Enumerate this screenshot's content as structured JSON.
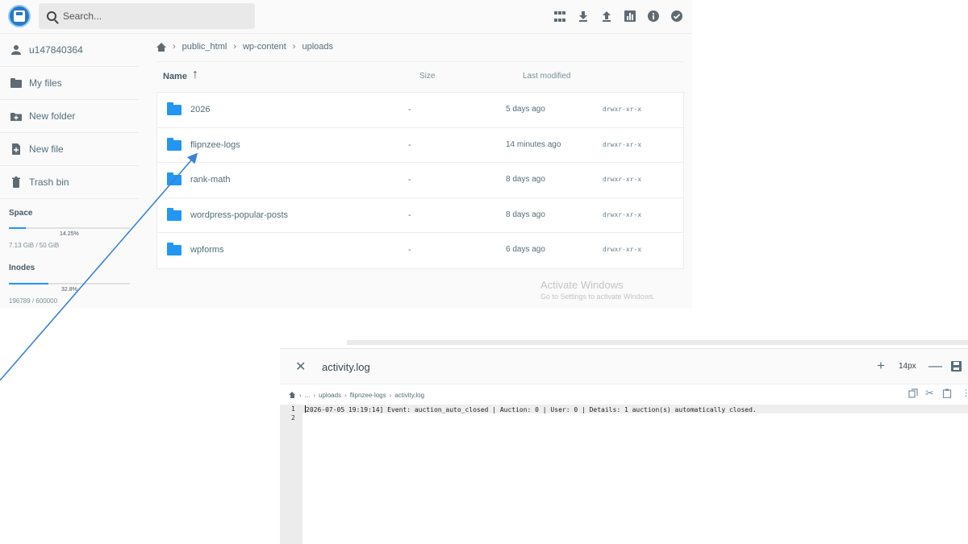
{
  "header": {
    "search_placeholder": "Search...",
    "toolbar_icons": [
      "grid-view-icon",
      "download-icon",
      "upload-icon",
      "chart-icon",
      "info-icon",
      "check-circle-icon"
    ]
  },
  "sidebar": {
    "items": [
      {
        "label": "u147840364",
        "icon": "user-icon"
      },
      {
        "label": "My files",
        "icon": "folder-icon"
      },
      {
        "label": "New folder",
        "icon": "new-folder-icon"
      },
      {
        "label": "New file",
        "icon": "new-file-icon"
      },
      {
        "label": "Trash bin",
        "icon": "trash-icon"
      }
    ],
    "space": {
      "title": "Space",
      "percent": "14.25%",
      "value": "7.13 GiB / 50 GiB",
      "fraction": 0.1425
    },
    "inodes": {
      "title": "Inodes",
      "percent": "32.8%",
      "value": "196789 / 600000",
      "fraction": 0.328
    }
  },
  "breadcrumb": [
    "public_html",
    "wp-content",
    "uploads"
  ],
  "list": {
    "columns": {
      "name": "Name",
      "size": "Size",
      "modified": "Last modified"
    },
    "rows": [
      {
        "name": "2026",
        "size": "-",
        "modified": "5 days ago",
        "perms": "drwxr-xr-x"
      },
      {
        "name": "flipnzee-logs",
        "size": "-",
        "modified": "14 minutes ago",
        "perms": "drwxr-xr-x"
      },
      {
        "name": "rank-math",
        "size": "-",
        "modified": "8 days ago",
        "perms": "drwxr-xr-x"
      },
      {
        "name": "wordpress-popular-posts",
        "size": "-",
        "modified": "8 days ago",
        "perms": "drwxr-xr-x"
      },
      {
        "name": "wpforms",
        "size": "-",
        "modified": "6 days ago",
        "perms": "drwxr-xr-x"
      }
    ]
  },
  "watermark": {
    "line1": "Activate Windows",
    "line2": "Go to Settings to activate Windows."
  },
  "editor": {
    "title": "activity.log",
    "font_size": "14px",
    "breadcrumb": [
      "...",
      "uploads",
      "flipnzee-logs",
      "activity.log"
    ],
    "lines": [
      {
        "number": "1",
        "text": "2026-07-05 19:19:14] Event: auction_auto_closed | Auction: 0 | User: 0 | Details: 1 auction(s) automatically closed."
      },
      {
        "number": "2",
        "text": ""
      }
    ]
  },
  "colors": {
    "accent": "#2196f3",
    "annotation_arrow": "#3b82d6"
  }
}
